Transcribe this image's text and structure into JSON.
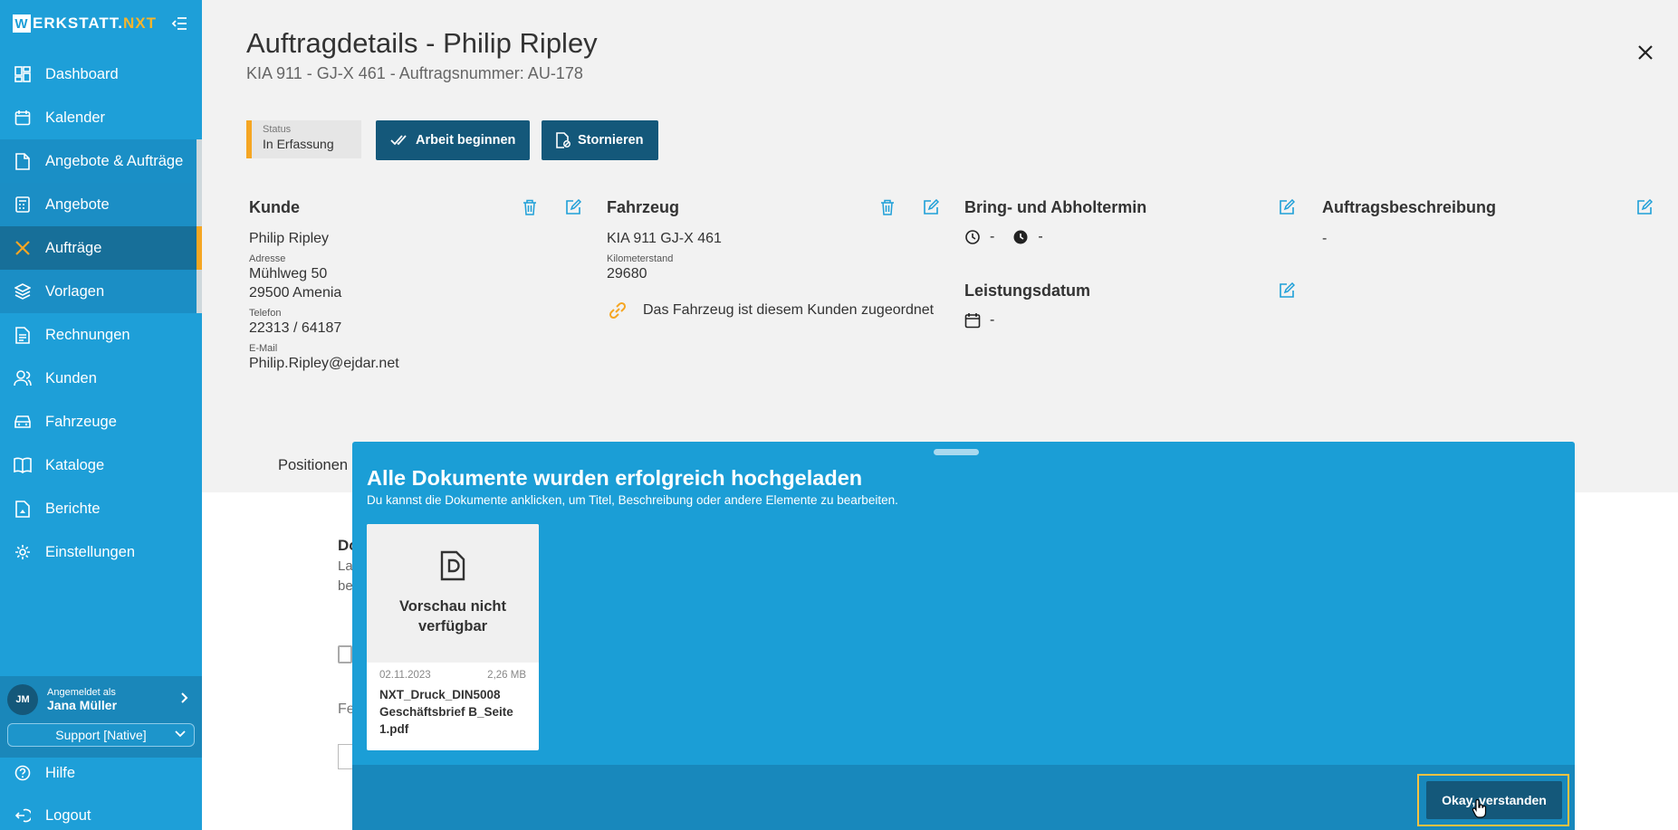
{
  "app": {
    "logo_w": "W",
    "logo_main": "ERKSTATT.",
    "logo_accent": "NXT"
  },
  "sidebar": {
    "items": [
      {
        "label": "Dashboard",
        "icon": "dashboard-icon"
      },
      {
        "label": "Kalender",
        "icon": "calendar-icon"
      },
      {
        "label": "Angebote & Aufträge",
        "icon": "document-icon"
      },
      {
        "label": "Angebote",
        "icon": "calculator-icon"
      },
      {
        "label": "Aufträge",
        "icon": "tools-icon"
      },
      {
        "label": "Vorlagen",
        "icon": "layers-icon"
      },
      {
        "label": "Rechnungen",
        "icon": "invoice-icon"
      },
      {
        "label": "Kunden",
        "icon": "users-icon"
      },
      {
        "label": "Fahrzeuge",
        "icon": "car-icon"
      },
      {
        "label": "Kataloge",
        "icon": "book-icon"
      },
      {
        "label": "Berichte",
        "icon": "report-icon"
      },
      {
        "label": "Einstellungen",
        "icon": "gear-icon"
      }
    ],
    "user": {
      "initials": "JM",
      "logged_in_label": "Angemeldet als",
      "name": "Jana Müller",
      "role_select": "Support [Native]"
    },
    "help": "Hilfe",
    "logout": "Logout"
  },
  "header": {
    "title": "Auftragdetails - Philip Ripley",
    "subtitle": "KIA 911 - GJ-X 461 - Auftragsnummer: AU-178"
  },
  "status": {
    "label": "Status",
    "value": "In Erfassung",
    "accent": "#f5a623"
  },
  "actions": {
    "start": "Arbeit beginnen",
    "cancel": "Stornieren"
  },
  "customer": {
    "heading": "Kunde",
    "name": "Philip Ripley",
    "address_label": "Adresse",
    "street": "Mühlweg 50",
    "city": "29500 Amenia",
    "phone_label": "Telefon",
    "phone": "22313 / 64187",
    "email_label": "E-Mail",
    "email": "Philip.Ripley@ejdar.net"
  },
  "vehicle": {
    "heading": "Fahrzeug",
    "name": "KIA 911 GJ-X 461",
    "km_label": "Kilometerstand",
    "km": "29680",
    "link_text": "Das Fahrzeug ist diesem Kunden zugeordnet"
  },
  "appointment": {
    "heading": "Bring- und Abholtermin",
    "bring": "-",
    "pickup": "-",
    "service_heading": "Leistungsdatum",
    "service_date": "-"
  },
  "description": {
    "heading": "Auftragsbeschreibung",
    "value": "-"
  },
  "tabs": {
    "positionen": "Positionen"
  },
  "behind": {
    "d": "Do",
    "la": "La",
    "be": "be",
    "fe": "Fe"
  },
  "modal": {
    "title": "Alle Dokumente wurden erfolgreich hochgeladen",
    "subtitle": "Du kannst die Dokumente anklicken, um Titel, Beschreibung oder andere Elemente zu bearbeiten.",
    "documents": [
      {
        "preview_text": "Vorschau nicht verfügbar",
        "date": "02.11.2023",
        "size": "2,26 MB",
        "name": "NXT_Druck_DIN5008 Geschäftsbrief B_Seite 1.pdf"
      }
    ],
    "ok_button": "Okay, verstanden"
  },
  "colors": {
    "sidebar": "#1e9fd8",
    "dark": "#14587a",
    "accent": "#f5a623",
    "modal": "#1b9ed6"
  }
}
